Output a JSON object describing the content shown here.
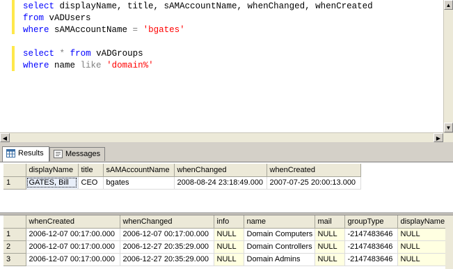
{
  "editor": {
    "lines": [
      [
        {
          "t": "select",
          "c": "#0000ff"
        },
        {
          "t": " displayName, title, sAMAccountName, whenChanged, whenCreated",
          "c": "#000000"
        }
      ],
      [
        {
          "t": "from",
          "c": "#0000ff"
        },
        {
          "t": " vADUsers",
          "c": "#000000"
        }
      ],
      [
        {
          "t": "where",
          "c": "#0000ff"
        },
        {
          "t": " sAMAccountName ",
          "c": "#000000"
        },
        {
          "t": "=",
          "c": "#808080"
        },
        {
          "t": " ",
          "c": "#000000"
        },
        {
          "t": "'bgates'",
          "c": "#ff0000"
        }
      ],
      [],
      [
        {
          "t": "select",
          "c": "#0000ff"
        },
        {
          "t": " ",
          "c": "#000000"
        },
        {
          "t": "*",
          "c": "#808080"
        },
        {
          "t": " ",
          "c": "#000000"
        },
        {
          "t": "from",
          "c": "#0000ff"
        },
        {
          "t": " vADGroups",
          "c": "#000000"
        }
      ],
      [
        {
          "t": "where",
          "c": "#0000ff"
        },
        {
          "t": " name ",
          "c": "#000000"
        },
        {
          "t": "like",
          "c": "#808080"
        },
        {
          "t": " ",
          "c": "#000000"
        },
        {
          "t": "'domain%'",
          "c": "#ff0000"
        }
      ]
    ]
  },
  "tabs": [
    {
      "label": "Results",
      "icon": "grid-icon",
      "active": true
    },
    {
      "label": "Messages",
      "icon": "messages-icon",
      "active": false
    }
  ],
  "users_grid": {
    "columns": [
      "displayName",
      "title",
      "sAMAccountName",
      "whenChanged",
      "whenCreated"
    ],
    "rows": [
      [
        "1",
        "GATES, Bill",
        "CEO",
        "bgates",
        "2008-08-24 23:18:49.000",
        "2007-07-25 20:00:13.000"
      ]
    ]
  },
  "groups_grid": {
    "columns": [
      "whenCreated",
      "whenChanged",
      "info",
      "name",
      "mail",
      "groupType",
      "displayName"
    ],
    "rows": [
      [
        "1",
        "2006-12-07 00:17:00.000",
        "2006-12-07 00:17:00.000",
        "NULL",
        "Domain Computers",
        "NULL",
        "-2147483646",
        "NULL"
      ],
      [
        "2",
        "2006-12-07 00:17:00.000",
        "2006-12-27 20:35:29.000",
        "NULL",
        "Domain Controllers",
        "NULL",
        "-2147483646",
        "NULL"
      ],
      [
        "3",
        "2006-12-07 00:17:00.000",
        "2006-12-27 20:35:29.000",
        "NULL",
        "Domain Admins",
        "NULL",
        "-2147483646",
        "NULL"
      ]
    ]
  },
  "colors": {
    "keyword": "#0000ff",
    "string": "#ff0000",
    "operator": "#808080",
    "change_bar": "#ffe84a",
    "null_cell": "#ffffe1"
  }
}
